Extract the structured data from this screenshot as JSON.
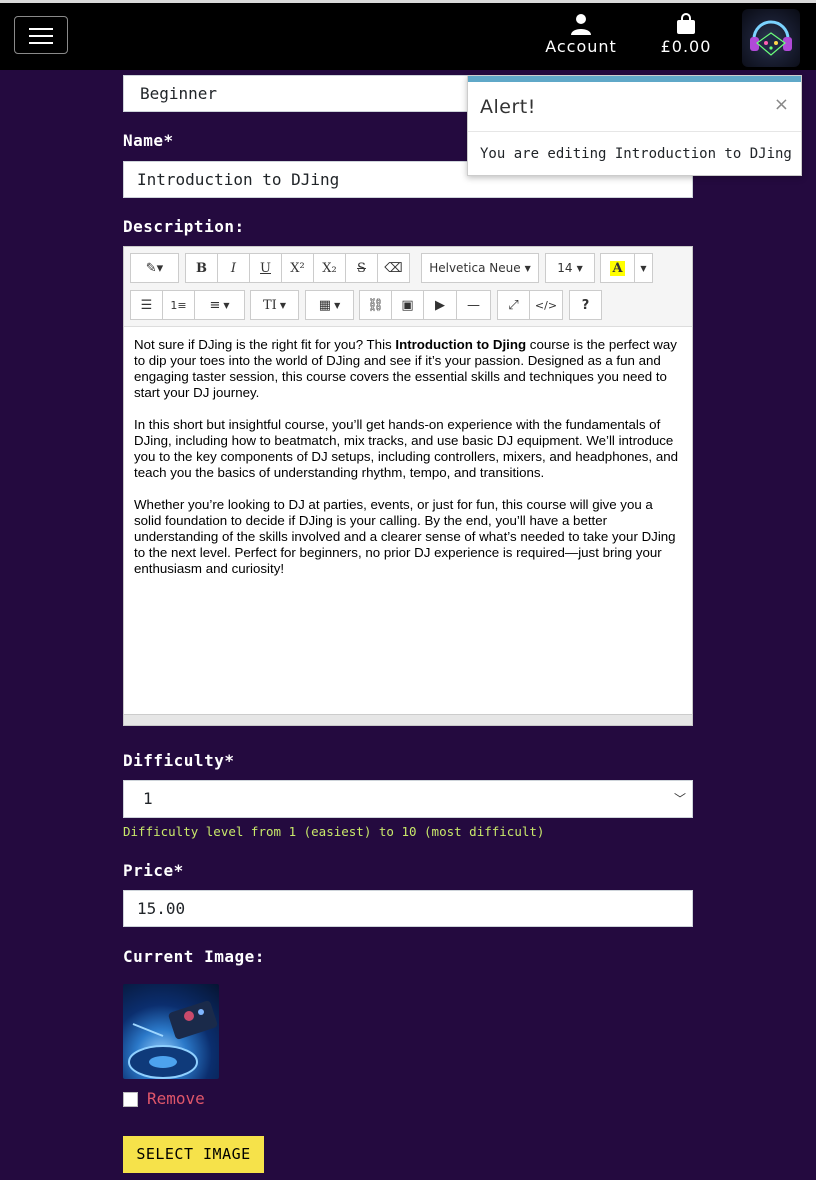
{
  "nav": {
    "account_label": "Account",
    "bag_total": "£0.00"
  },
  "form": {
    "level_value": "Beginner",
    "name_label": "Name*",
    "name_value": "Introduction to DJing",
    "description_label": "Description:",
    "toolbar": {
      "font_name": "Helvetica Neue",
      "font_size": "14"
    },
    "description_paragraphs": [
      "Not sure if DJing is the right fit for you? This ",
      "Introduction to Djing",
      " course is the perfect way to dip your toes into the world of DJing and see if it’s your passion. Designed as a fun and engaging taster session, this course covers the essential skills and techniques you need to start your DJ journey.",
      "In this short but insightful course, you’ll get hands-on experience with the fundamentals of DJing, including how to beatmatch, mix tracks, and use basic DJ equipment. We’ll introduce you to the key components of DJ setups, including controllers, mixers, and headphones, and teach you the basics of understanding rhythm, tempo, and transitions.",
      "Whether you’re looking to DJ at parties, events, or just for fun, this course will give you a solid foundation to decide if DJing is your calling. By the end, you’ll have a better understanding of the skills involved and a clearer sense of what’s needed to take your DJing to the next level. Perfect for beginners, no prior DJ experience is required—just bring your enthusiasm and curiosity!"
    ],
    "difficulty_label": "Difficulty*",
    "difficulty_value": "1",
    "difficulty_help": "Difficulty level from 1 (easiest) to 10 (most difficult)",
    "price_label": "Price*",
    "price_value": "15.00",
    "current_image_label": "Current Image:",
    "remove_label": "Remove",
    "select_image_label": "SELECT IMAGE"
  },
  "alert": {
    "title": "Alert!",
    "close": "×",
    "message": "You are editing Introduction to DJing"
  },
  "colors": {
    "page_bg": "#240a3f",
    "accent_yellow": "#f6e24a",
    "help_text": "#c8e86a",
    "remove_text": "#e0566a",
    "alert_accent": "#5fa8c8"
  }
}
